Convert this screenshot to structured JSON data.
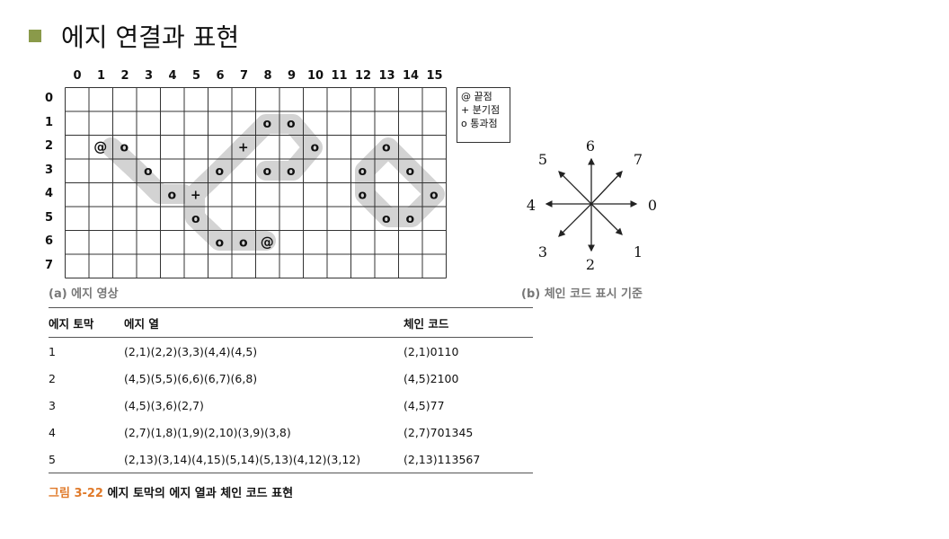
{
  "title": "에지 연결과 표현",
  "grid": {
    "columns": [
      "0",
      "1",
      "2",
      "3",
      "4",
      "5",
      "6",
      "7",
      "8",
      "9",
      "10",
      "11",
      "12",
      "13",
      "14",
      "15"
    ],
    "rows": [
      "0",
      "1",
      "2",
      "3",
      "4",
      "5",
      "6",
      "7"
    ],
    "marks": [
      {
        "r": 1,
        "c": 8,
        "s": "o"
      },
      {
        "r": 1,
        "c": 9,
        "s": "o"
      },
      {
        "r": 2,
        "c": 1,
        "s": "@"
      },
      {
        "r": 2,
        "c": 2,
        "s": "o"
      },
      {
        "r": 2,
        "c": 7,
        "s": "+"
      },
      {
        "r": 2,
        "c": 10,
        "s": "o"
      },
      {
        "r": 2,
        "c": 13,
        "s": "o"
      },
      {
        "r": 3,
        "c": 3,
        "s": "o"
      },
      {
        "r": 3,
        "c": 6,
        "s": "o"
      },
      {
        "r": 3,
        "c": 8,
        "s": "o"
      },
      {
        "r": 3,
        "c": 9,
        "s": "o"
      },
      {
        "r": 3,
        "c": 12,
        "s": "o"
      },
      {
        "r": 3,
        "c": 14,
        "s": "o"
      },
      {
        "r": 4,
        "c": 4,
        "s": "o"
      },
      {
        "r": 4,
        "c": 5,
        "s": "+"
      },
      {
        "r": 4,
        "c": 12,
        "s": "o"
      },
      {
        "r": 4,
        "c": 15,
        "s": "o"
      },
      {
        "r": 5,
        "c": 5,
        "s": "o"
      },
      {
        "r": 5,
        "c": 13,
        "s": "o"
      },
      {
        "r": 5,
        "c": 14,
        "s": "o"
      },
      {
        "r": 6,
        "c": 6,
        "s": "o"
      },
      {
        "r": 6,
        "c": 7,
        "s": "o"
      },
      {
        "r": 6,
        "c": 8,
        "s": "@"
      }
    ],
    "legend": [
      "@ 끝점",
      "+ 분기점",
      "o 통과점"
    ],
    "caption": "(a) 에지 영상"
  },
  "chain": {
    "directions": [
      "0",
      "1",
      "2",
      "3",
      "4",
      "5",
      "6",
      "7"
    ],
    "caption": "(b) 체인 코드 표시 기준"
  },
  "table": {
    "headers": [
      "에지 토막",
      "에지 열",
      "체인 코드"
    ],
    "rows": [
      {
        "id": "1",
        "seq": "(2,1)(2,2)(3,3)(4,4)(4,5)",
        "code": "(2,1)0110"
      },
      {
        "id": "2",
        "seq": "(4,5)(5,5)(6,6)(6,7)(6,8)",
        "code": "(4,5)2100"
      },
      {
        "id": "3",
        "seq": "(4,5)(3,6)(2,7)",
        "code": "(4,5)77"
      },
      {
        "id": "4",
        "seq": "(2,7)(1,8)(1,9)(2,10)(3,9)(3,8)",
        "code": "(2,7)701345"
      },
      {
        "id": "5",
        "seq": "(2,13)(3,14)(4,15)(5,14)(5,13)(4,12)(3,12)",
        "code": "(2,13)113567"
      }
    ]
  },
  "figure": {
    "number": "그림 3-22",
    "text": " 에지 토막의 에지 열과 체인 코드 표현"
  }
}
